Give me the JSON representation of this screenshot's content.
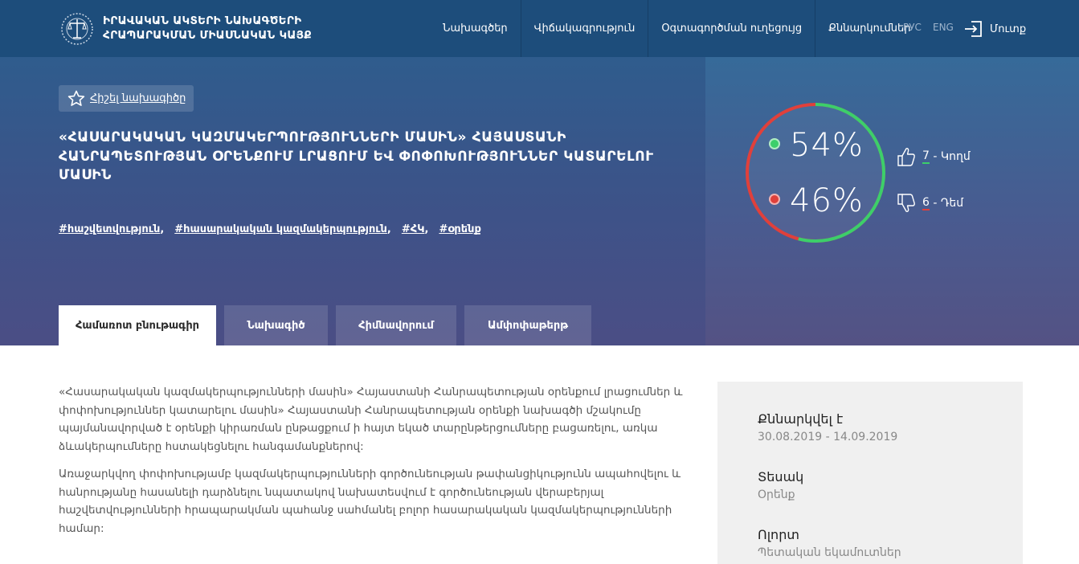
{
  "header": {
    "site_title_line1": "ԻՐԱՎԱԿԱՆ ԱԿՏԵՐԻ ՆԱԽԱԳԾԵՐԻ",
    "site_title_line2": "ՀՐԱՊԱՐԱԿՄԱՆ ՄԻԱՍՆԱԿԱՆ ԿԱՅՔ",
    "nav": [
      "Նախագծեր",
      "Վիճակագրություն",
      "Օգտագործման ուղեցույց",
      "Քննարկումներ"
    ],
    "lang_ru": "РУС",
    "lang_en": "ENG",
    "login_label": "Մուտք"
  },
  "hero": {
    "favorite_label": "Հիշել նախագիծը",
    "title": "«ՀԱՍԱՐԱԿԱԿԱՆ ԿԱԶՄԱԿԵՐՊՈՒԹՅՈՒՆՆԵՐԻ ՄԱՍԻՆ» ՀԱՅԱՍՏԱՆԻ ՀԱՆՐԱՊԵՏՈՒԹՅԱՆ ՕՐԵՆՔՈՒՄ ԼՐԱՑՈՒՄ ԵՎ ՓՈՓՈԽՈՒԹՅՈՒՆՆԵՐ ԿԱՏԱՐԵԼՈՒ ՄԱՍԻՆ",
    "tags": [
      "#հաշվետվություն",
      "#հասարակական կազմակերպություն",
      "#ՀԿ",
      "#օրենք"
    ],
    "tabs": [
      "Համառոտ բնութագիր",
      "Նախագիծ",
      "Հիմնավորում",
      "Ամփոփաթերթ"
    ]
  },
  "votes": {
    "yes_percent": "54%",
    "no_percent": "46%",
    "yes_fraction": 0.54,
    "yes_count": "7",
    "yes_label": " - Կողմ",
    "no_count": "6",
    "no_label": " - Դեմ",
    "yes_color": "#3ccf6a",
    "no_color": "#e0403b"
  },
  "content": {
    "paragraph1": "«Հասարակական կազմակերպությունների մասին» Հայաստանի Հանրապետության օրենքում լրացումներ և փոփոխություններ կատարելու մասին» Հայաստանի Հանրապետության օրենքի նախագծի մշակումը պայմանավորված է օրենքի կիրառման ընթացքում ի հայտ եկած տարընթերցումները բացառելու, առկա ձևակերպումները հստակեցնելու հանգամանքներով:",
    "paragraph2": "Առաջարկվող փոփոխությամբ կազմակերպությունների գործունեության թափանցիկությունն ապահովելու և հանրությանը հասանելի դարձնելու նպատակով նախատեսվում է գործունեության վերաբերյալ հաշվետվությունների հրապարակման պահանջ սահմանել բոլոր հասարակական կազմակերպությունների համար:"
  },
  "sidebar": {
    "discussed_label": "Քննարկվել է",
    "discussed_value": "30.08.2019 - 14.09.2019",
    "type_label": "Տեսակ",
    "type_value": "Օրենք",
    "area_label": "Ոլորտ",
    "area_value": "Պետական եկամուտներ"
  }
}
